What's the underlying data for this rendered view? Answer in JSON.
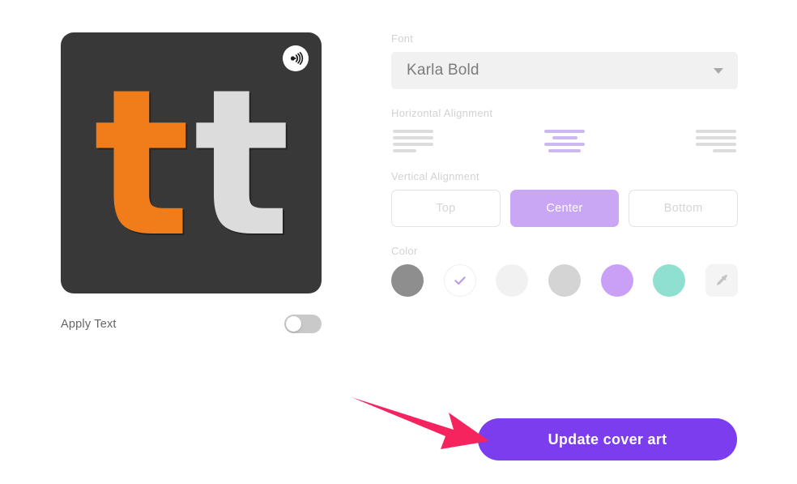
{
  "cover_art": {
    "name": "cover-art-preview",
    "background_color": "#383838",
    "letters": [
      {
        "char": "t",
        "color": "#f07d1a"
      },
      {
        "char": "t",
        "color": "#dcdcdc"
      }
    ],
    "badge_icon": "podcast-broadcast-icon"
  },
  "apply_text": {
    "label": "Apply Text",
    "toggle_state": "off"
  },
  "font": {
    "label": "Font",
    "value": "Karla Bold",
    "chevron_icon": "chevron-down-icon"
  },
  "horizontal_alignment": {
    "label": "Horizontal Alignment",
    "options": [
      {
        "value": "left",
        "icon": "align-left-icon",
        "selected": false
      },
      {
        "value": "center",
        "icon": "align-center-icon",
        "selected": true
      },
      {
        "value": "right",
        "icon": "align-right-icon",
        "selected": false
      }
    ],
    "selected_color": "#cdb9f2",
    "unselected_color": "#dddddd"
  },
  "vertical_alignment": {
    "label": "Vertical Alignment",
    "options": [
      {
        "label": "Top",
        "selected": false
      },
      {
        "label": "Center",
        "selected": true
      },
      {
        "label": "Bottom",
        "selected": false
      }
    ],
    "selected_color": "#c9a7f5"
  },
  "color": {
    "label": "Color",
    "swatches": [
      {
        "name": "gray-dark",
        "hex": "#8e8e8e",
        "selected": false
      },
      {
        "name": "white",
        "hex": "#ffffff",
        "selected": true
      },
      {
        "name": "off-white",
        "hex": "#f1f1f1",
        "selected": false
      },
      {
        "name": "light-gray",
        "hex": "#d4d4d4",
        "selected": false
      },
      {
        "name": "purple",
        "hex": "#c9a0f5",
        "selected": false
      },
      {
        "name": "teal",
        "hex": "#8fe0d0",
        "selected": false
      },
      {
        "name": "eyedropper",
        "hex": "#f4f4f4",
        "selected": false,
        "icon": "eyedropper-icon"
      }
    ],
    "check_color": "#b79ae8"
  },
  "update_button": {
    "label": "Update cover art",
    "color": "#7c3dee"
  },
  "annotation": {
    "name": "red-arrow",
    "color": "#f5245e",
    "points_to": "update-cover-art-button"
  }
}
